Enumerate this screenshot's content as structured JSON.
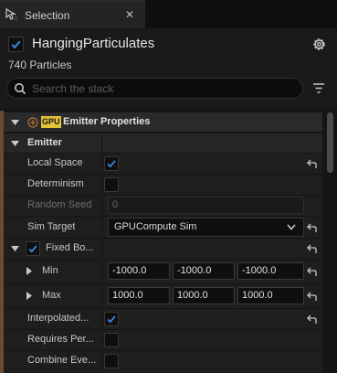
{
  "tab": {
    "title": "Selection",
    "close": "✕"
  },
  "header": {
    "emitter_name": "HangingParticulates",
    "enabled": true,
    "particle_count": "740 Particles"
  },
  "search": {
    "placeholder": "Search the stack",
    "value": ""
  },
  "stack": {
    "section_title": "Emitter Properties",
    "badge": "GPU",
    "group_title": "Emitter",
    "properties": [
      {
        "label": "Local Space",
        "type": "checkbox",
        "checked": true,
        "resettable": true
      },
      {
        "label": "Determinism",
        "type": "checkbox",
        "checked": false,
        "resettable": false
      },
      {
        "label": "Random Seed",
        "type": "number",
        "value": "0",
        "disabled": true,
        "resettable": false
      },
      {
        "label": "Sim Target",
        "type": "dropdown",
        "value": "GPUCompute Sim",
        "resettable": true
      },
      {
        "label": "Fixed Bo...",
        "type": "group-checkbox",
        "checked": true,
        "resettable": true
      },
      {
        "label": "Min",
        "type": "vector",
        "values": [
          "-1000.0",
          "-1000.0",
          "-1000.0"
        ],
        "resettable": true
      },
      {
        "label": "Max",
        "type": "vector",
        "values": [
          "1000.0",
          "1000.0",
          "1000.0"
        ],
        "resettable": true
      },
      {
        "label": "Interpolated...",
        "type": "checkbox",
        "checked": true,
        "resettable": true
      },
      {
        "label": "Requires Per...",
        "type": "checkbox",
        "checked": false,
        "resettable": false
      },
      {
        "label": "Combine Eve...",
        "type": "checkbox",
        "checked": false,
        "resettable": false
      }
    ]
  },
  "colors": {
    "accent_check": "#3b8ee8",
    "emitter_accent": "#6b4a31",
    "badge_yellow": "#e4c23a"
  }
}
